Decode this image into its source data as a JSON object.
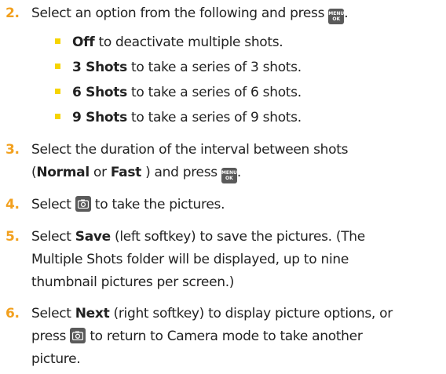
{
  "step2": {
    "num": "2.",
    "text": "Select an option from the following and press",
    "after": ".",
    "bullets": [
      {
        "bold": "Off",
        "text": "to deactivate multiple shots."
      },
      {
        "bold": "3 Shots",
        "text": "to take a series of 3 shots."
      },
      {
        "bold": "6 Shots",
        "text": "to take a series of 6 shots."
      },
      {
        "bold": "9 Shots",
        "text": "to take a series of 9 shots."
      }
    ]
  },
  "step3": {
    "num": "3.",
    "line1": "Select the duration of the interval between shots",
    "open": "(",
    "bold1": "Normal",
    "or": " or ",
    "bold2": "Fast",
    "close_press": " ) and press",
    "after": "."
  },
  "step4": {
    "num": "4.",
    "pre": "Select",
    "post": "to take the pictures."
  },
  "step5": {
    "num": "5.",
    "pre": "Select ",
    "bold": "Save",
    "line1": " (left softkey) to save the pictures. (The",
    "line2": "Multiple Shots folder will be displayed, up to nine",
    "line3": "thumbnail pictures per screen.)"
  },
  "step6": {
    "num": "6.",
    "pre": "Select ",
    "bold": "Next",
    "line1": " (right softkey) to display picture options, or",
    "line2_pre": "press",
    "line2_post": "to return to Camera mode to take another",
    "line3": "picture."
  },
  "icons": {
    "menu_top": "MENU",
    "menu_bottom": "OK",
    "menu_icon": "menu-ok-key-icon",
    "camera_icon": "camera-key-icon"
  }
}
